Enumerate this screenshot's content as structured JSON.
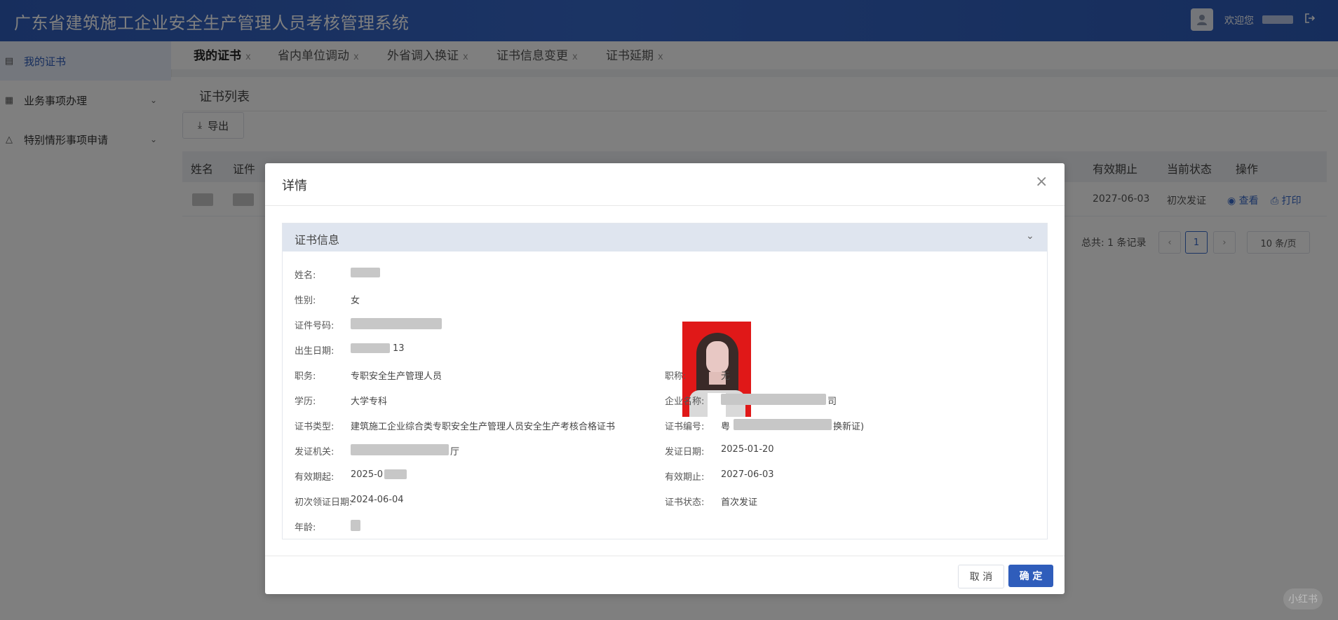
{
  "header": {
    "title": "广东省建筑施工企业安全生产管理人员考核管理系统",
    "welcome": "欢迎您"
  },
  "sidebar": {
    "items": [
      {
        "label": "我的证书",
        "icon": "certificate-icon"
      },
      {
        "label": "业务事项办理",
        "icon": "document-icon"
      },
      {
        "label": "特别情形事项申请",
        "icon": "warning-icon"
      }
    ]
  },
  "tabs": [
    {
      "label": "我的证书"
    },
    {
      "label": "省内单位调动"
    },
    {
      "label": "外省调入换证"
    },
    {
      "label": "证书信息变更"
    },
    {
      "label": "证书延期"
    }
  ],
  "main": {
    "list_title": "证书列表",
    "export_label": "导出",
    "columns": {
      "name": "姓名",
      "id_prefix": "证件",
      "valid_to": "有效期止",
      "status": "当前状态",
      "actions": "操作"
    },
    "row": {
      "valid_to": "2027-06-03",
      "status": "初次发证",
      "view": "查看",
      "print": "打印"
    },
    "pagination": {
      "total": "总共: 1 条记录",
      "current": "1",
      "page_size": "10 条/页"
    }
  },
  "modal": {
    "title": "详情",
    "section_title": "证书信息",
    "left_fields": [
      {
        "label": "姓名:",
        "value": ""
      },
      {
        "label": "性别:",
        "value": "女"
      },
      {
        "label": "证件号码:",
        "value": ""
      },
      {
        "label": "出生日期:",
        "value": "13"
      },
      {
        "label": "职务:",
        "value": "专职安全生产管理人员"
      },
      {
        "label": "学历:",
        "value": "大学专科"
      },
      {
        "label": "证书类型:",
        "value": "建筑施工企业综合类专职安全生产管理人员安全生产考核合格证书"
      },
      {
        "label": "发证机关:",
        "value": "厅"
      },
      {
        "label": "有效期起:",
        "value": "2025-0"
      },
      {
        "label": "初次领证日期:",
        "value": "2024-06-04"
      },
      {
        "label": "年龄:",
        "value": ""
      }
    ],
    "right_fields": [
      {
        "label": "职称:",
        "value": "无"
      },
      {
        "label": "企业名称:",
        "value": "司"
      },
      {
        "label": "证书编号:",
        "value": "粤",
        "note": "换新证)"
      },
      {
        "label": "发证日期:",
        "value": "2025-01-20"
      },
      {
        "label": "有效期止:",
        "value": "2027-06-03"
      },
      {
        "label": "证书状态:",
        "value": "首次发证"
      }
    ],
    "cancel_label": "取 消",
    "ok_label": "确 定"
  },
  "colors": {
    "header": "#2f5dbb",
    "primary": "#2f5dbb",
    "photo_bg": "#e01818",
    "note": "#e83e6c"
  },
  "watermark": "小红书"
}
